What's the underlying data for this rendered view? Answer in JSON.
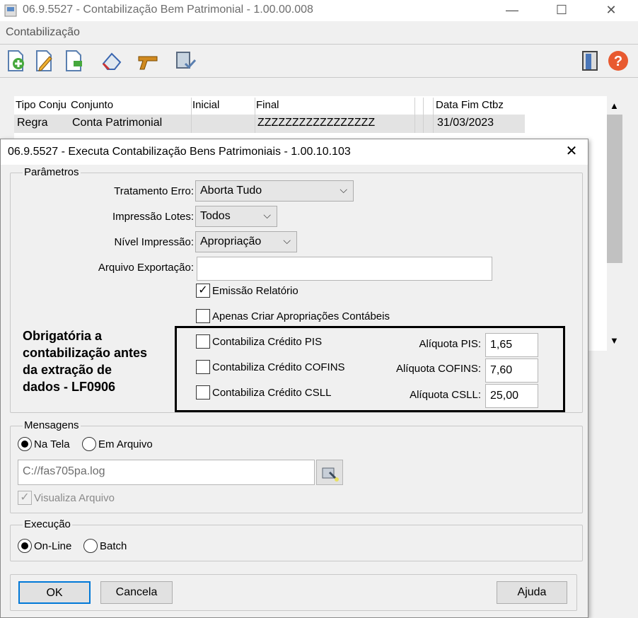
{
  "background_window": {
    "title": "06.9.5527 - Contabilização Bem Patrimonial - 1.00.00.008",
    "menu_label": "Contabilização",
    "window_buttons": {
      "minimize": "—",
      "maximize": "☐",
      "close": "✕"
    },
    "toolbar_icons": [
      "add-icon",
      "edit-icon",
      "copy-icon",
      "eraser-icon",
      "gun-icon",
      "document-check-icon"
    ],
    "grid": {
      "headers": [
        "Tipo Conju",
        "Conjunto",
        "Inicial",
        "Final",
        "",
        "",
        "Data Fim Ctbz"
      ],
      "row": [
        "Regra",
        "Conta Patrimonial",
        "",
        "ZZZZZZZZZZZZZZZZZ",
        "",
        "",
        "31/03/2023"
      ]
    }
  },
  "dialog": {
    "title": "06.9.5527 - Executa Contabilização Bens Patrimoniais - 1.00.10.103",
    "close_glyph": "✕",
    "parametros": {
      "group_label": "Parâmetros",
      "tratamento_erro_label": "Tratamento Erro:",
      "tratamento_erro_value": "Aborta Tudo",
      "impressao_lotes_label": "Impressão Lotes:",
      "impressao_lotes_value": "Todos",
      "nivel_impressao_label": "Nível Impressão:",
      "nivel_impressao_value": "Apropriação",
      "arquivo_exportacao_label": "Arquivo Exportação:",
      "arquivo_exportacao_value": "",
      "emissao_relatorio_label": "Emissão Relatório",
      "emissao_relatorio_checked": true,
      "apenas_criar_label": "Apenas Criar Apropriações Contábeis",
      "pis_label": "Contabiliza Crédito PIS",
      "cofins_label": "Contabiliza Crédito COFINS",
      "csll_label": "Contabiliza Crédito CSLL",
      "aliquota_pis_label": "Alíquota PIS:",
      "aliquota_pis_value": "1,65",
      "aliquota_cofins_label": "Alíquota COFINS:",
      "aliquota_cofins_value": "7,60",
      "aliquota_csll_label": "Alíquota CSLL:",
      "aliquota_csll_value": "25,00"
    },
    "mensagens": {
      "group_label": "Mensagens",
      "na_tela_label": "Na Tela",
      "em_arquivo_label": "Em Arquivo",
      "file_value": "C://fas705pa.log",
      "visualiza_label": "Visualiza Arquivo"
    },
    "execucao": {
      "group_label": "Execução",
      "online_label": "On-Line",
      "batch_label": "Batch"
    },
    "buttons": {
      "ok": "OK",
      "cancela": "Cancela",
      "ajuda": "Ajuda"
    }
  },
  "annotation": {
    "lines": [
      "Obrigatória a",
      "contabilização antes",
      "da extração de",
      "dados - LF0906"
    ]
  }
}
